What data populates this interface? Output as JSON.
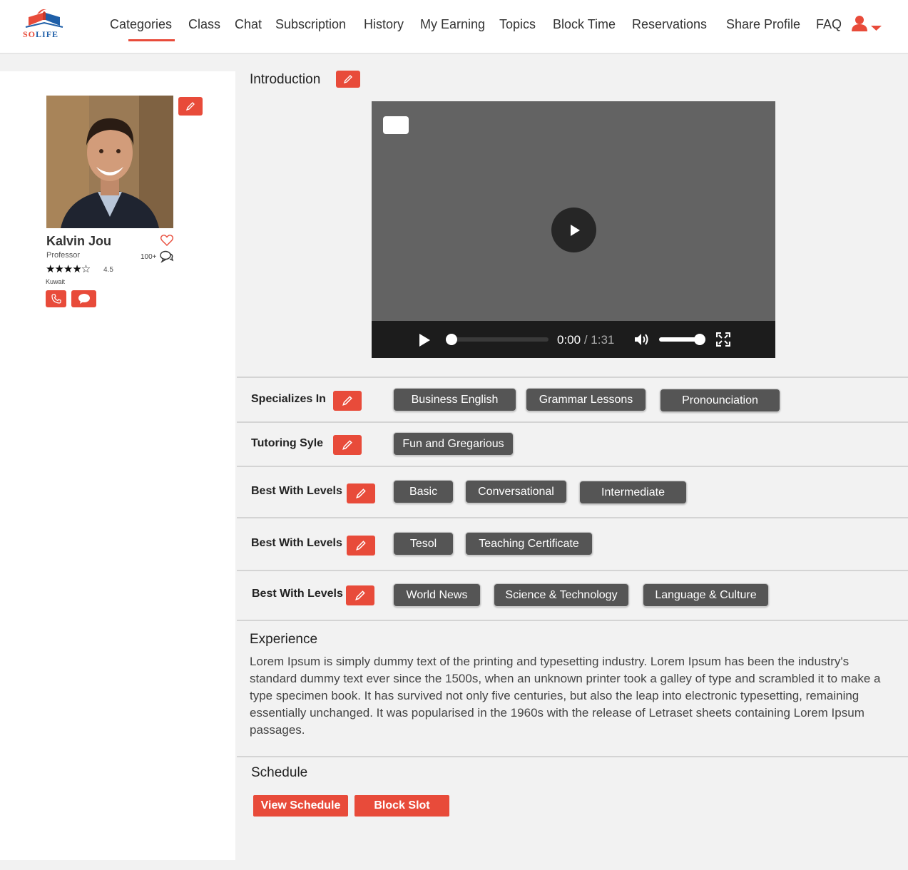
{
  "brand": {
    "name": "SOLIFE",
    "name_a": "SO",
    "name_b": "LIFE",
    "primary_color": "#e84b3a",
    "secondary_color": "#1f5fa8"
  },
  "nav": {
    "items": [
      {
        "label": "Categories",
        "active": true
      },
      {
        "label": "Class"
      },
      {
        "label": "Chat"
      },
      {
        "label": "Subscription"
      },
      {
        "label": "History"
      },
      {
        "label": "My Earning"
      },
      {
        "label": "Topics"
      },
      {
        "label": "Block Time"
      },
      {
        "label": "Reservations"
      },
      {
        "label": "Share Profile"
      },
      {
        "label": "FAQ"
      }
    ],
    "user_icon": "user-icon",
    "dropdown_icon": "caret-down-icon"
  },
  "profile": {
    "name": "Kalvin Jou",
    "title": "Professor",
    "stars": "★★★★☆",
    "rating": "4.5",
    "location": "Kuwait",
    "reviews": "100+"
  },
  "introduction": {
    "label": "Introduction",
    "video": {
      "current_time": "0:00",
      "separator": "/",
      "duration": "1:31"
    }
  },
  "sections": [
    {
      "label": "Specializes In",
      "tags": [
        "Business English",
        "Grammar Lessons",
        "Pronounciation"
      ]
    },
    {
      "label": "Tutoring Syle",
      "tags": [
        "Fun and Gregarious"
      ]
    },
    {
      "label": "Best With Levels",
      "tags": [
        "Basic",
        "Conversational",
        "Intermediate"
      ]
    },
    {
      "label": "Best With Levels",
      "tags": [
        "Tesol",
        "Teaching Certificate"
      ]
    },
    {
      "label": "Best With Levels",
      "tags": [
        "World News",
        "Science & Technology",
        "Language & Culture"
      ]
    }
  ],
  "experience": {
    "title": "Experience",
    "text": "Lorem Ipsum is simply dummy text of the printing and typesetting industry. Lorem Ipsum has been the industry's standard dummy text ever since the 1500s, when an unknown printer took a galley of type and scrambled it to make a type specimen book. It has survived not only five centuries, but also the leap into electronic typesetting, remaining essentially unchanged. It was popularised in the 1960s with the release of Letraset sheets containing Lorem Ipsum passages."
  },
  "schedule": {
    "title": "Schedule",
    "view_label": "View Schedule",
    "block_label": "Block Slot"
  }
}
